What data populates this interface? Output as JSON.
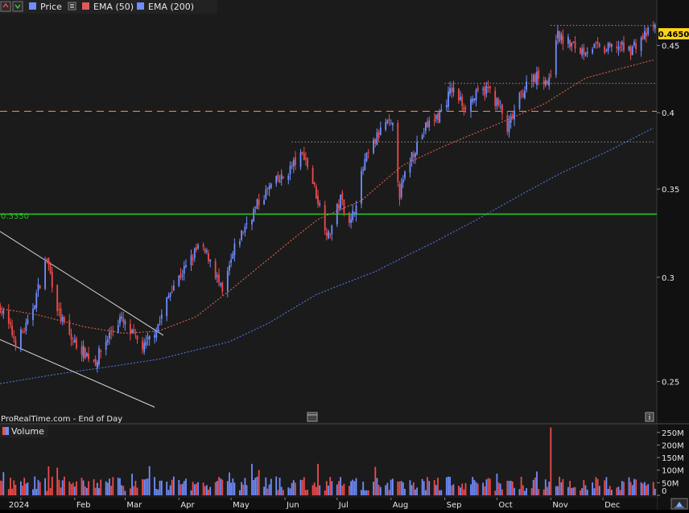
{
  "legend": {
    "price": "Price",
    "ema50": "EMA (50)",
    "ema200": "EMA (200)"
  },
  "watermark": "ProRealTime.com - End of Day",
  "volume_title": "Volume",
  "support_label": "0.3350",
  "last_price_label": "0.4650",
  "colors": {
    "background": "#1b1b1b",
    "up": "#6f8dff",
    "down": "#ef4a4a",
    "ema50": "#e0604a",
    "ema200": "#4f75e0",
    "support": "#22c21a",
    "resistance_dashed": "#e8804a",
    "last_price_bg": "#ffd11a"
  },
  "chart_data": [
    {
      "type": "candlestick",
      "title": "",
      "x_ticks": [
        "2024",
        "Feb",
        "Mar",
        "Apr",
        "May",
        "Jun",
        "Jul",
        "Aug",
        "Sep",
        "Oct",
        "Nov",
        "Dec"
      ],
      "y_ticks": [
        0.25,
        0.3,
        0.35,
        0.4,
        0.45
      ],
      "y_tick_labels": [
        "0.25",
        "0.3",
        "0.35",
        "0.4",
        "0.45"
      ],
      "ylim": [
        0.2325,
        0.475
      ],
      "scale": "log",
      "x_range": [
        "2023-12-20",
        "2025-01-01"
      ],
      "price_path": [
        [
          "2023-12-20",
          0.285
        ],
        [
          "2023-12-29",
          0.268
        ],
        [
          "2024-01-05",
          0.276
        ],
        [
          "2024-01-11",
          0.294
        ],
        [
          "2024-01-16",
          0.31
        ],
        [
          "2024-01-23",
          0.281
        ],
        [
          "2024-01-30",
          0.269
        ],
        [
          "2024-02-08",
          0.262
        ],
        [
          "2024-02-13",
          0.259
        ],
        [
          "2024-02-20",
          0.27
        ],
        [
          "2024-02-27",
          0.279
        ],
        [
          "2024-03-05",
          0.271
        ],
        [
          "2024-03-12",
          0.265
        ],
        [
          "2024-03-21",
          0.278
        ],
        [
          "2024-03-28",
          0.295
        ],
        [
          "2024-04-05",
          0.305
        ],
        [
          "2024-04-12",
          0.316
        ],
        [
          "2024-04-19",
          0.31
        ],
        [
          "2024-04-26",
          0.291
        ],
        [
          "2024-05-03",
          0.315
        ],
        [
          "2024-05-10",
          0.33
        ],
        [
          "2024-05-17",
          0.342
        ],
        [
          "2024-05-24",
          0.352
        ],
        [
          "2024-05-31",
          0.357
        ],
        [
          "2024-06-07",
          0.367
        ],
        [
          "2024-06-12",
          0.372
        ],
        [
          "2024-06-19",
          0.347
        ],
        [
          "2024-06-26",
          0.322
        ],
        [
          "2024-07-03",
          0.344
        ],
        [
          "2024-07-09",
          0.33
        ],
        [
          "2024-07-17",
          0.367
        ],
        [
          "2024-07-24",
          0.383
        ],
        [
          "2024-07-29",
          0.393
        ],
        [
          "2024-08-02",
          0.389
        ],
        [
          "2024-08-06",
          0.347
        ],
        [
          "2024-08-13",
          0.372
        ],
        [
          "2024-08-21",
          0.39
        ],
        [
          "2024-08-29",
          0.399
        ],
        [
          "2024-09-05",
          0.417
        ],
        [
          "2024-09-12",
          0.405
        ],
        [
          "2024-09-19",
          0.412
        ],
        [
          "2024-09-26",
          0.417
        ],
        [
          "2024-10-02",
          0.405
        ],
        [
          "2024-10-07",
          0.388
        ],
        [
          "2024-10-14",
          0.41
        ],
        [
          "2024-10-21",
          0.427
        ],
        [
          "2024-10-28",
          0.425
        ],
        [
          "2024-10-31",
          0.421
        ],
        [
          "2024-11-04",
          0.458
        ],
        [
          "2024-11-11",
          0.452
        ],
        [
          "2024-11-18",
          0.446
        ],
        [
          "2024-11-25",
          0.449
        ],
        [
          "2024-12-02",
          0.446
        ],
        [
          "2024-12-09",
          0.45
        ],
        [
          "2024-12-16",
          0.446
        ],
        [
          "2024-12-23",
          0.455
        ],
        [
          "2024-12-31",
          0.465
        ]
      ],
      "ema50_path": [
        [
          "2023-12-20",
          0.284
        ],
        [
          "2024-01-10",
          0.281
        ],
        [
          "2024-02-07",
          0.275
        ],
        [
          "2024-02-29",
          0.272
        ],
        [
          "2024-03-20",
          0.273
        ],
        [
          "2024-04-11",
          0.28
        ],
        [
          "2024-05-03",
          0.295
        ],
        [
          "2024-05-23",
          0.31
        ],
        [
          "2024-06-20",
          0.332
        ],
        [
          "2024-07-15",
          0.343
        ],
        [
          "2024-08-08",
          0.365
        ],
        [
          "2024-09-02",
          0.378
        ],
        [
          "2024-10-01",
          0.392
        ],
        [
          "2024-10-28",
          0.406
        ],
        [
          "2024-11-21",
          0.425
        ],
        [
          "2024-12-31",
          0.439
        ]
      ],
      "ema200_path": [
        [
          "2023-12-20",
          0.249
        ],
        [
          "2024-01-20",
          0.253
        ],
        [
          "2024-02-25",
          0.257
        ],
        [
          "2024-03-21",
          0.26
        ],
        [
          "2024-04-30",
          0.268
        ],
        [
          "2024-05-23",
          0.277
        ],
        [
          "2024-06-19",
          0.291
        ],
        [
          "2024-07-23",
          0.303
        ],
        [
          "2024-08-26",
          0.319
        ],
        [
          "2024-09-18",
          0.331
        ],
        [
          "2024-10-14",
          0.346
        ],
        [
          "2024-11-07",
          0.36
        ],
        [
          "2024-12-04",
          0.374
        ],
        [
          "2024-12-31",
          0.39
        ]
      ],
      "support_level": 0.335,
      "resistance_dashed_level": 0.401,
      "dotted_levels": [
        {
          "value": 0.466,
          "from": "2024-11-01",
          "to": "2024-12-31"
        },
        {
          "value": 0.421,
          "from": "2024-09-01",
          "to": "2024-12-31"
        },
        {
          "value": 0.38,
          "from": "2024-06-05",
          "to": "2024-12-31"
        }
      ],
      "trend_channel": {
        "upper": [
          [
            "2023-12-20",
            0.325
          ],
          [
            "2024-03-23",
            0.271
          ]
        ],
        "lower": [
          [
            "2023-12-20",
            0.269
          ],
          [
            "2024-03-18",
            0.239
          ]
        ]
      },
      "last_price": 0.465
    },
    {
      "type": "bar",
      "title": "Volume",
      "y_ticks": [
        0,
        50000000,
        100000000,
        150000000,
        200000000,
        250000000
      ],
      "y_tick_labels": [
        "0",
        "50M",
        "100M",
        "150M",
        "200M",
        "250M"
      ],
      "ylim": [
        0,
        275000000
      ],
      "typical_volume": 50000000,
      "spikes": [
        {
          "date": "2024-01-17",
          "value": 115000000
        },
        {
          "date": "2024-05-13",
          "value": 125000000
        },
        {
          "date": "2024-06-20",
          "value": 125000000
        },
        {
          "date": "2024-11-01",
          "value": 270000000
        }
      ]
    }
  ]
}
